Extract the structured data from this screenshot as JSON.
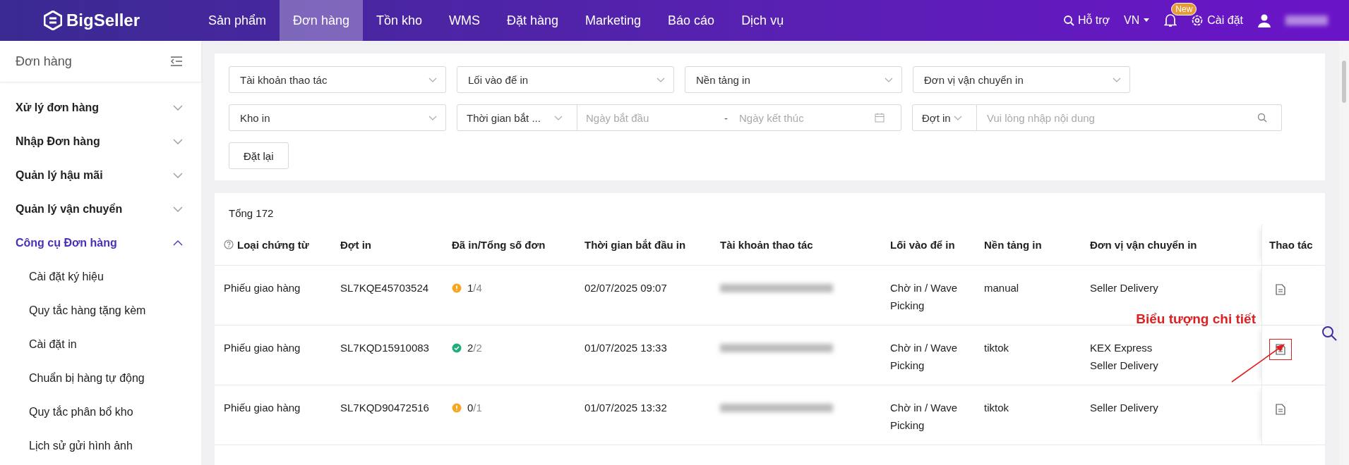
{
  "topbar": {
    "logo": "BigSeller",
    "nav": [
      {
        "label": "Sản phẩm",
        "selected": false
      },
      {
        "label": "Đơn hàng",
        "selected": true
      },
      {
        "label": "Tồn kho",
        "selected": false
      },
      {
        "label": "WMS",
        "selected": false
      },
      {
        "label": "Đặt hàng",
        "selected": false
      },
      {
        "label": "Marketing",
        "selected": false
      },
      {
        "label": "Báo cáo",
        "selected": false
      },
      {
        "label": "Dịch vụ",
        "selected": false
      }
    ],
    "support": "Hỗ trợ",
    "language": "VN",
    "badge": "New",
    "settings": "Cài đặt"
  },
  "sidebar": {
    "title": "Đơn hàng",
    "items": [
      {
        "label": "Xử lý đơn hàng",
        "expanded": false
      },
      {
        "label": "Nhập Đơn hàng",
        "expanded": false
      },
      {
        "label": "Quản lý hậu mãi",
        "expanded": false
      },
      {
        "label": "Quản lý vận chuyển",
        "expanded": false
      },
      {
        "label": "Công cụ Đơn hàng",
        "expanded": true,
        "children": [
          "Cài đặt ký hiệu",
          "Quy tắc hàng tặng kèm",
          "Cài đặt in",
          "Chuẩn bị hàng tự động",
          "Quy tắc phân bổ kho",
          "Lịch sử gửi hình ảnh"
        ]
      }
    ]
  },
  "filters": {
    "selects": [
      "Tài khoản thao tác",
      "Lối vào để in",
      "Nền tảng in",
      "Đơn vị vận chuyển in"
    ],
    "warehouse": "Kho in",
    "time_type": "Thời gian bắt ...",
    "start_placeholder": "Ngày bắt đầu",
    "separator": "-",
    "end_placeholder": "Ngày kết thúc",
    "batch_type": "Đợt in",
    "search_placeholder": "Vui lòng nhập nội dung",
    "reset": "Đặt lại"
  },
  "table": {
    "total": "Tổng 172",
    "columns": [
      "Loại chứng từ",
      "Đợt in",
      "Đã in/Tổng số đơn",
      "Thời gian bắt đầu in",
      "Tài khoản thao tác",
      "Lối vào để in",
      "Nền tảng in",
      "Đơn vị vận chuyển in",
      "Thao tác"
    ],
    "rows": [
      {
        "type": "Phiếu giao hàng",
        "batch": "SL7KQE45703524",
        "kind": "warning",
        "printed": "1",
        "total": "/4",
        "time": "02/07/2025 09:07",
        "entry": "Chờ in / Wave Picking",
        "platform": "manual",
        "carriers": [
          "Seller Delivery"
        ],
        "highlighted": false
      },
      {
        "type": "Phiếu giao hàng",
        "batch": "SL7KQD15910083",
        "kind": "done",
        "printed": "2",
        "total": "/2",
        "time": "01/07/2025 13:33",
        "entry": "Chờ in / Wave Picking",
        "platform": "tiktok",
        "carriers": [
          "KEX Express",
          "Seller Delivery"
        ],
        "highlighted": true
      },
      {
        "type": "Phiếu giao hàng",
        "batch": "SL7KQD90472516",
        "kind": "warning",
        "printed": "0",
        "total": "/1",
        "time": "01/07/2025 13:32",
        "entry": "Chờ in / Wave Picking",
        "platform": "tiktok",
        "carriers": [
          "Seller Delivery"
        ],
        "highlighted": false
      }
    ]
  },
  "annotation": "Biểu tượng chi tiết"
}
